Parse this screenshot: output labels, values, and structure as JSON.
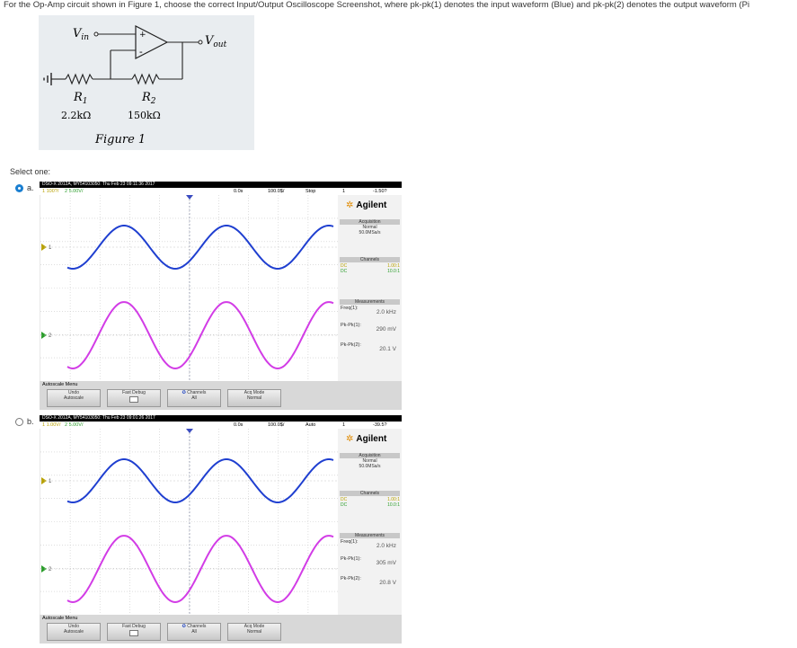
{
  "question": "For the Op-Amp circuit shown in Figure 1, choose the correct Input/Output Oscilloscope Screenshot, where pk-pk(1) denotes the input waveform (Blue) and pk-pk(2) denotes the output waveform (Pi",
  "figure": {
    "vin": "V",
    "vin_sub": "in",
    "vout": "V",
    "vout_sub": "out",
    "r1": "R",
    "r1_sub": "1",
    "r2": "R",
    "r2_sub": "2",
    "r1_val": "2.2kΩ",
    "r2_val": "150kΩ",
    "caption": "Figure 1",
    "plus": "+",
    "minus": "-"
  },
  "select_one": "Select one:",
  "options": [
    {
      "letter": "a.",
      "selected": true,
      "scope": {
        "header": "DSO-X 2012A, MY54103050: Thu Feb 23 09:11:36 2017",
        "ch1_scale": "1  100?/",
        "ch2_scale": "2  5.00V/",
        "time_pos": "0.0s",
        "time_scale": "100.0$/",
        "run_state": "Stop",
        "trig": "1",
        "trig_level": "-1.50?",
        "brand": "Agilent",
        "acq_header": "Acquisition",
        "acq_mode": "Normal",
        "acq_rate": "50.0MSa/s",
        "channels_header": "Channels",
        "ch1_coupling": "DC",
        "ch1_ratio": "1.00:1",
        "ch2_coupling": "DC",
        "ch2_ratio": "10.0:1",
        "meas_header": "Measurements",
        "freq_label": "Freq(1):",
        "freq_value": "2.0 kHz",
        "pk1_label": "Pk-Pk(1):",
        "pk1_value": "290 mV",
        "pk2_label": "Pk-Pk(2):",
        "pk2_value": "20.1 V",
        "menu_title": "Autoscale Menu",
        "softkeys": [
          {
            "l1": "Undo",
            "l2": "Autoscale"
          },
          {
            "l1": "Fast Debug",
            "l2": ""
          },
          {
            "l1": "Channels",
            "l2": "All"
          },
          {
            "l1": "Acq Mode",
            "l2": "Normal"
          }
        ],
        "ch1_marker": "1",
        "ch2_marker": "2"
      }
    },
    {
      "letter": "b.",
      "selected": false,
      "scope": {
        "header": "DSO-X 2012A, MY54103050: Thu Feb 23 09:01:26 2017",
        "ch1_scale": "1  1.00V/",
        "ch2_scale": "2  5.00V/",
        "time_pos": "0.0s",
        "time_scale": "100.0$/",
        "run_state": "Auto",
        "trig": "1",
        "trig_level": "-39.5?",
        "brand": "Agilent",
        "acq_header": "Acquisition",
        "acq_mode": "Normal",
        "acq_rate": "50.0MSa/s",
        "channels_header": "Channels",
        "ch1_coupling": "DC",
        "ch1_ratio": "1.00:1",
        "ch2_coupling": "DC",
        "ch2_ratio": "10.0:1",
        "meas_header": "Measurements",
        "freq_label": "Freq(1):",
        "freq_value": "2.0 kHz",
        "pk1_label": "Pk-Pk(1):",
        "pk1_value": "305 mV",
        "pk2_label": "Pk-Pk(2):",
        "pk2_value": "20.8 V",
        "menu_title": "Autoscale Menu",
        "softkeys": [
          {
            "l1": "Undo",
            "l2": "Autoscale"
          },
          {
            "l1": "Fast Debug",
            "l2": ""
          },
          {
            "l1": "Channels",
            "l2": "All"
          },
          {
            "l1": "Acq Mode",
            "l2": "Normal"
          }
        ],
        "ch1_marker": "1",
        "ch2_marker": "2"
      }
    }
  ],
  "colors": {
    "ch1_trace": "#1f3fd0",
    "ch2_trace": "#d23ce6",
    "radio_selected": "#1a7fd1",
    "figure_bg": "#e9edf0"
  }
}
